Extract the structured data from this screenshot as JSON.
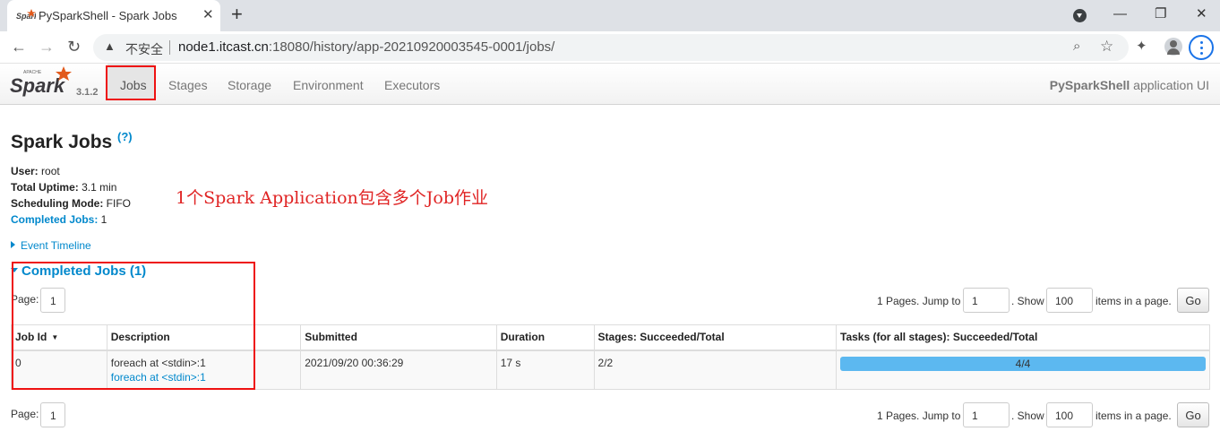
{
  "browser": {
    "tab_title": "PySparkShell - Spark Jobs",
    "insecure_label": "不安全",
    "url_host": "node1.itcast.cn",
    "url_rest": ":18080/history/app-20210920003545-0001/jobs/"
  },
  "navbar": {
    "version": "3.1.2",
    "items": [
      "Jobs",
      "Stages",
      "Storage",
      "Environment",
      "Executors"
    ],
    "active": "Jobs",
    "app_name": "PySparkShell",
    "app_suffix": " application UI"
  },
  "page": {
    "title": "Spark Jobs",
    "help": "(?)",
    "user_label": "User:",
    "user_value": " root",
    "uptime_label": "Total Uptime:",
    "uptime_value": " 3.1 min",
    "mode_label": "Scheduling Mode:",
    "mode_value": " FIFO",
    "completed_label": "Completed Jobs:",
    "completed_value": " 1",
    "event_timeline": "Event Timeline",
    "annotation": "1个Spark Application包含多个Job作业",
    "section_title": "Completed Jobs (1)"
  },
  "pagination": {
    "page_label": "Page:",
    "page_value": "1",
    "pages_text": "1 Pages. Jump to",
    "jump_value": "1",
    "show_text": ". Show",
    "show_value": "100",
    "items_text": "items in a page.",
    "go_label": "Go"
  },
  "table": {
    "headers": [
      "Job Id",
      "Description",
      "Submitted",
      "Duration",
      "Stages: Succeeded/Total",
      "Tasks (for all stages): Succeeded/Total"
    ],
    "rows": [
      {
        "job_id": "0",
        "description": "foreach at <stdin>:1",
        "description_link": "foreach at <stdin>:1",
        "submitted": "2021/09/20 00:36:29",
        "duration": "17 s",
        "stages": "2/2",
        "tasks": "4/4",
        "tasks_progress": 1.0
      }
    ]
  },
  "colors": {
    "link": "#0088cc",
    "progress": "#5cb8f0",
    "annotation": "#e02424"
  }
}
